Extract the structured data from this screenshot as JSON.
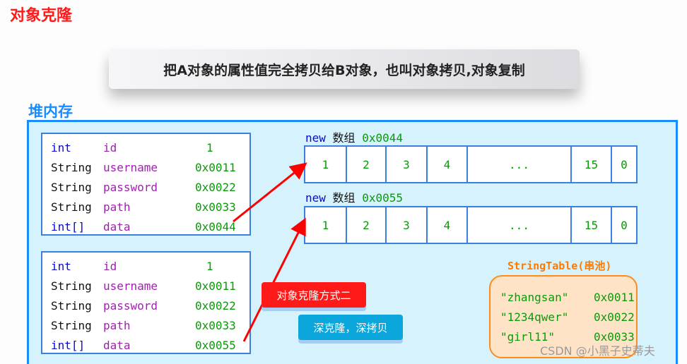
{
  "title": "对象克隆",
  "banner": "把A对象的属性值完全拷贝给B对象，也叫对象拷贝,对象复制",
  "heap_label": "堆内存",
  "objects": [
    {
      "rows": [
        {
          "type": "int",
          "name": "id",
          "value": "1"
        },
        {
          "type": "String",
          "name": "username",
          "value": "0x0011"
        },
        {
          "type": "String",
          "name": "password",
          "value": "0x0022"
        },
        {
          "type": "String",
          "name": "path",
          "value": "0x0033"
        },
        {
          "type": "int[]",
          "name": "data",
          "value": "0x0044"
        }
      ]
    },
    {
      "rows": [
        {
          "type": "int",
          "name": "id",
          "value": "1"
        },
        {
          "type": "String",
          "name": "username",
          "value": "0x0011"
        },
        {
          "type": "String",
          "name": "password",
          "value": "0x0022"
        },
        {
          "type": "String",
          "name": "path",
          "value": "0x0033"
        },
        {
          "type": "int[]",
          "name": "data",
          "value": "0x0055"
        }
      ]
    }
  ],
  "arrays": [
    {
      "kw": "new",
      "label": "数组",
      "addr": "0x0044",
      "cells": [
        "1",
        "2",
        "3",
        "4",
        "...",
        "15",
        "0"
      ]
    },
    {
      "kw": "new",
      "label": "数组",
      "addr": "0x0055",
      "cells": [
        "1",
        "2",
        "3",
        "4",
        "...",
        "15",
        "0"
      ]
    }
  ],
  "buttons": {
    "method2": "对象克隆方式二",
    "deep": "深克隆，深拷贝"
  },
  "string_table": {
    "label": "StringTable(串池)",
    "entries": [
      {
        "str": "\"zhangsan\"",
        "addr": "0x0011"
      },
      {
        "str": "\"1234qwer\"",
        "addr": "0x0022"
      },
      {
        "str": "\"girl11\"",
        "addr": "0x0033"
      }
    ]
  },
  "watermark": "CSDN @小黑子史蒂夫",
  "colors": {
    "title": "#ff1a1a",
    "heap_border": "#1a8cff",
    "heap_bg": "#d6f3fd",
    "arrow": "#ff0000",
    "button_red": "#ff1a1a",
    "button_blue": "#0aa6dc",
    "string_table": "#ff8c1a"
  }
}
